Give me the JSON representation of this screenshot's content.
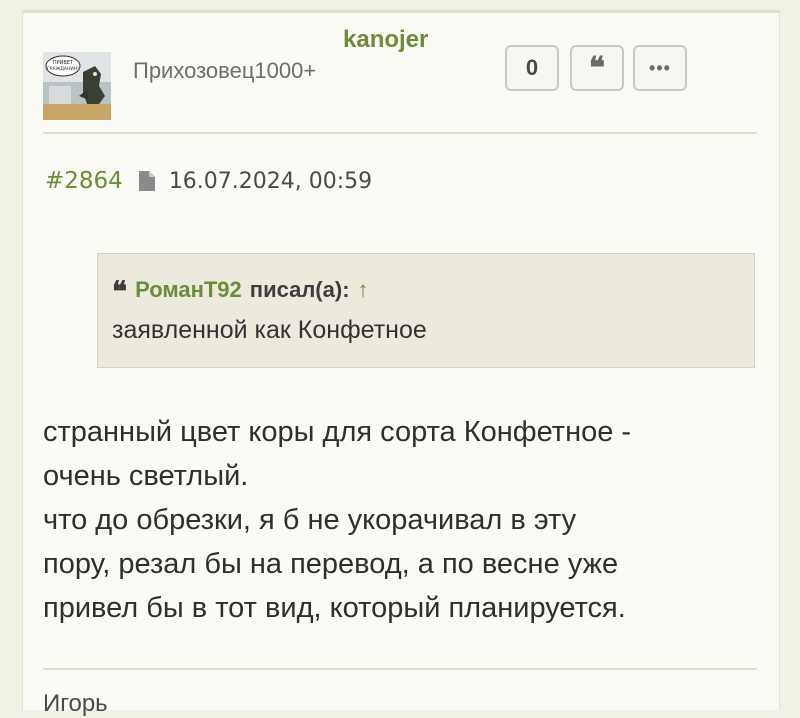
{
  "post": {
    "author": "kanojer",
    "rank": "Прихозовец1000+",
    "avatar_sign": "ПРИВЕТ ГРАЖДАНИН!",
    "actions": {
      "count": "0",
      "quote_glyph": "❝",
      "more_glyph": "•••"
    },
    "number": "#2864",
    "date": "16.07.2024, 00:59",
    "quote": {
      "author": "РоманТ92",
      "said": "писал(а):",
      "arrow": "↑",
      "text": "заявленной как Конфетное"
    },
    "body_lines": [
      "странный цвет коры для сорта Конфетное -",
      "очень светлый.",
      "что до обрезки, я б не укорачивал в эту",
      "пору, резал бы на перевод, а по весне уже",
      "привел бы в тот вид, который планируется."
    ],
    "signature": "Игорь"
  },
  "colors": {
    "accent": "#6b8c3a",
    "card_bg": "#fbfbf5",
    "quote_bg": "#ebeadd"
  }
}
